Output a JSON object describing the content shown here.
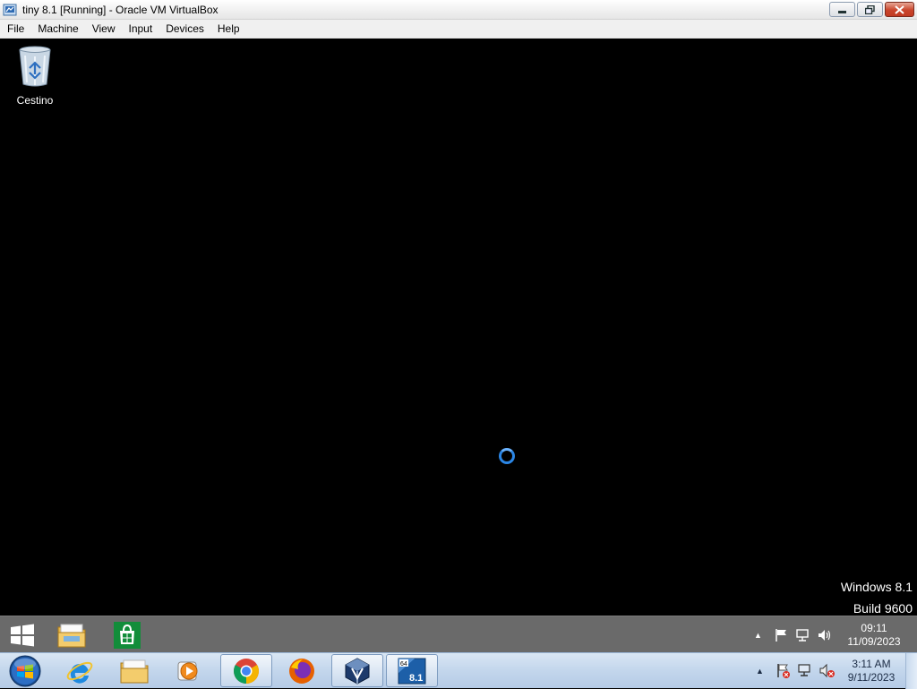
{
  "window": {
    "title": "tiny 8.1 [Running] - Oracle VM VirtualBox",
    "controls": {
      "minimize": "minimize",
      "restore": "restore",
      "close": "close"
    }
  },
  "menubar": {
    "items": [
      "File",
      "Machine",
      "View",
      "Input",
      "Devices",
      "Help"
    ]
  },
  "guest": {
    "desktop_icons": [
      {
        "label": "Cestino",
        "icon": "recycle-bin-icon"
      }
    ],
    "loading_indicator": "spinner",
    "watermark": {
      "line1": "Windows 8.1",
      "line2": "Build 9600"
    },
    "taskbar": {
      "pinned": [
        "windows-start-icon",
        "file-explorer-icon",
        "store-icon"
      ],
      "tray_icons": [
        "show-hidden-icons",
        "flag-icon",
        "network-icon",
        "volume-icon"
      ],
      "clock": {
        "time": "09:11",
        "date": "11/09/2023"
      }
    }
  },
  "host": {
    "taskbar": {
      "items": [
        "start-orb-icon",
        "internet-explorer-icon",
        "windows-explorer-icon",
        "media-player-icon",
        "chrome-icon",
        "firefox-icon",
        "virtualbox-icon",
        "tiny81-vm-icon"
      ],
      "active_items": [
        "chrome-icon",
        "virtualbox-icon",
        "tiny81-vm-icon"
      ],
      "vm_badge": {
        "top": "64",
        "bottom": "8.1"
      },
      "tray_icons": [
        "show-hidden-icons",
        "action-center-icon",
        "network-icon",
        "volume-muted-icon"
      ],
      "clock": {
        "time": "3:11 AM",
        "date": "9/11/2023"
      }
    }
  },
  "colors": {
    "spinner": "#2b86e5",
    "guest_taskbar": "#6a6a6a",
    "host_taskbar": "#c3d6ec"
  }
}
